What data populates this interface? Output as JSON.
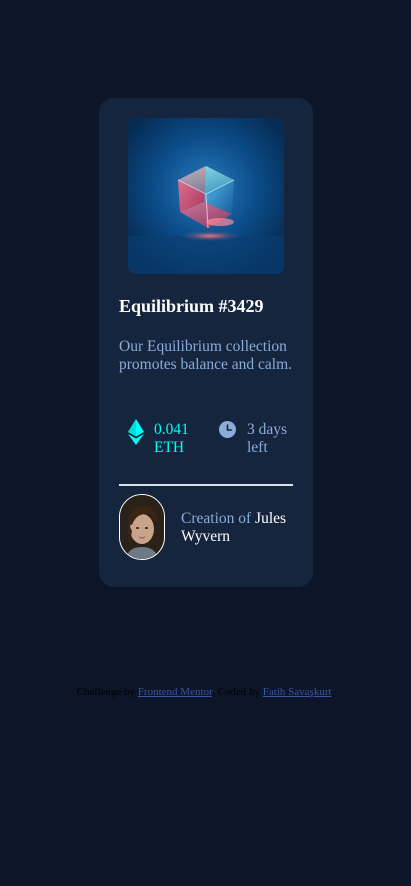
{
  "card": {
    "title": "Equilibrium #3429",
    "description": "Our Equilibrium collection promotes balance and calm.",
    "price": {
      "value": "0.041",
      "unit": "ETH",
      "icon": "ethereum-icon"
    },
    "time_left": {
      "value": "3 days",
      "unit": "left",
      "icon": "clock-icon"
    },
    "creator": {
      "prefix": "Creation of",
      "name": "Jules Wyvern"
    }
  },
  "footer": {
    "text_challenge": "Challenge by",
    "link_challenge": "Frontend Mentor",
    "text_coded": "Coded by",
    "link_coded": "Fatih Savaşkurt"
  },
  "colors": {
    "background": "#0d1628",
    "card": "#15253d",
    "accent_cyan": "#00fff8",
    "soft_blue": "#8bacd9",
    "white": "#ffffff"
  }
}
